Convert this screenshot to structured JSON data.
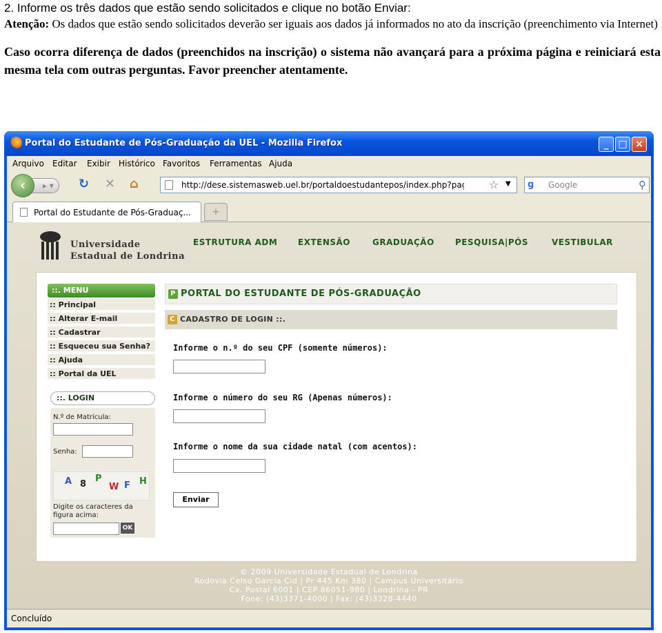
{
  "instructions": {
    "line1": "2. Informe os três dados que estão sendo solicitados e clique no botão Enviar:",
    "attention_label": "Atenção:",
    "attention_text": " Os dados que estão sendo solicitados deverão ser iguais aos dados já informados no ato da inscrição (preenchimento via Internet)",
    "warning": "Caso ocorra diferença de dados (preenchidos na inscrição) o sistema não avançará para a próxima página e reiniciará esta mesma tela com outras perguntas. Favor preencher atentamente."
  },
  "browser": {
    "window_title": "Portal do Estudante de Pós-Graduação da UEL - Mozilla Firefox",
    "menu": [
      "Arquivo",
      "Editar",
      "Exibir",
      "Histórico",
      "Favoritos",
      "Ferramentas",
      "Ajuda"
    ],
    "url": "http://dese.sistemasweb.uel.br/portaldoestudantepos/index.php?pagina=cadastı",
    "search_engine_letter": "g",
    "search_placeholder": "Google",
    "tab_label": "Portal do Estudante de Pós-Graduaç...",
    "new_tab_symbol": "+",
    "status": "Concluído"
  },
  "site": {
    "logo_line1": "Universidade",
    "logo_line2": "Estadual de Londrina",
    "nav": [
      "ESTRUTURA ADM",
      "EXTENSÃO",
      "GRADUAÇÃO",
      "PESQUISA|PÓS",
      "VESTIBULAR"
    ],
    "menu_header": "::. MENU",
    "menu_items": [
      ":: Principal",
      ":: Alterar E-mail",
      ":: Cadastrar",
      ":: Esqueceu sua Senha?",
      ":: Ajuda",
      ":: Portal da UEL"
    ],
    "login_header": "::. LOGIN",
    "matricula_label": "N.º de Matrícula:",
    "senha_label": "Senha:",
    "captcha_chars": [
      "A",
      "8",
      "P",
      "W",
      "F",
      "H"
    ],
    "captcha_prompt_1": "Digite os caracteres da",
    "captcha_prompt_2": "figura acima:",
    "ok_label": "OK",
    "portal_badge": "P",
    "portal_title": "PORTAL DO ESTUDANTE DE PÓS-GRADUAÇÃO",
    "cadastro_badge": "C",
    "cadastro_title": "CADASTRO DE LOGIN ::.",
    "q1": "Informe o n.º do seu CPF (somente números):",
    "q2": "Informe o número do seu RG (Apenas números):",
    "q3": "Informe o nome da sua cidade natal (com acentos):",
    "submit_label": "Enviar",
    "footer": [
      "© 2009 Universidade Estadual de Londrina",
      "Rodovia Celso Garcia Cid | Pr 445 Km 380 | Campus Universitário",
      "Cx. Postal 6001 | CEP 86051-980 | Londrina - PR",
      "Fone: (43)3371-4000 | Fax: (43)3328-4440"
    ]
  },
  "colors": {
    "titlebar": "#0a55e0",
    "site_green": "#1f5a1f",
    "menu_green": "#4f9a34"
  }
}
